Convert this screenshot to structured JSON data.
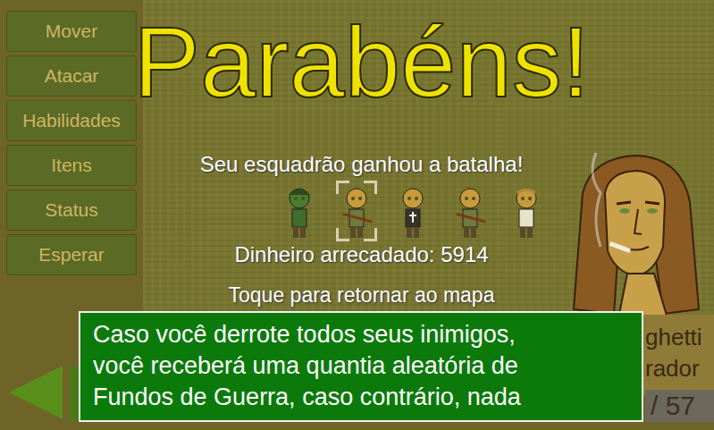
{
  "menu": [
    {
      "label": "Mover"
    },
    {
      "label": "Atacar"
    },
    {
      "label": "Habilidades"
    },
    {
      "label": "Itens"
    },
    {
      "label": "Status"
    },
    {
      "label": "Esperar"
    }
  ],
  "victory": {
    "title": "Parabéns!",
    "message": "Seu esquadrão ganhou a batalha!",
    "squad": [
      {
        "kind": "soldier",
        "selected": false,
        "color": "#3f6e2c"
      },
      {
        "kind": "rifleman",
        "selected": true,
        "color": "#6f7a3c"
      },
      {
        "kind": "priest",
        "selected": false,
        "color": "#3a3226"
      },
      {
        "kind": "rifleman",
        "selected": false,
        "color": "#6f7a3c"
      },
      {
        "kind": "civilian",
        "selected": false,
        "color": "#e8e2c8"
      }
    ],
    "money": "Dinheiro arrecadado: 5914",
    "prompt": "Toque para retornar ao mapa"
  },
  "unit_panel": {
    "name": "ghetti",
    "role": "rador",
    "hp": "/ 57"
  },
  "tip": {
    "lines": [
      "Caso você derrote todos seus inimigos,",
      "você receberá uma quantia aleatória de",
      "Fundos de Guerra, caso contrário, nada"
    ]
  }
}
